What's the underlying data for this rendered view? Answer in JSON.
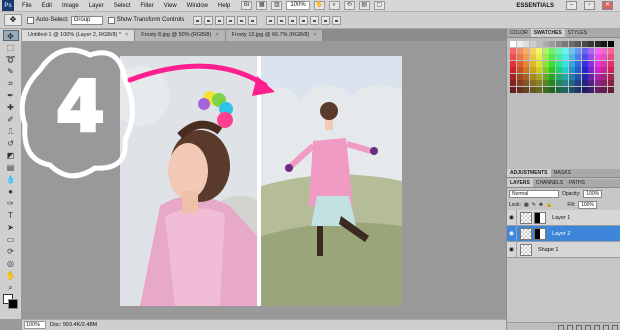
{
  "menubar": {
    "logo": "Ps",
    "items": [
      "File",
      "Edit",
      "Image",
      "Layer",
      "Select",
      "Filter",
      "View",
      "Window",
      "Help"
    ],
    "zoom": "100%",
    "workspace": "ESSENTIALS"
  },
  "options": {
    "auto_select_label": "Auto-Select:",
    "auto_select_value": "Group",
    "transform_label": "Show Transform Controls"
  },
  "tabs": [
    {
      "label": "Untitled-1 @ 100% (Layer 2, RGB/8) *",
      "active": true
    },
    {
      "label": "Frosty 8.jpg @ 50% (RGB/8)",
      "active": false
    },
    {
      "label": "Frosty 12.jpg @ 66.7% (RGB/8)",
      "active": false
    }
  ],
  "status": {
    "zoom": "100%",
    "doc": "Doc: 993.4K/2.48M"
  },
  "right_panel": {
    "top_tabs": [
      "COLOR",
      "SWATCHES",
      "STYLES"
    ],
    "adj_tabs": [
      "ADJUSTMENTS",
      "MASKS"
    ],
    "layer_tabs": [
      "LAYERS",
      "CHANNELS",
      "PATHS"
    ],
    "blend_mode": "Normal",
    "opacity_label": "Opacity:",
    "opacity": "100%",
    "lock_label": "Lock:",
    "fill_label": "Fill:",
    "fill": "100%",
    "layers": [
      {
        "name": "Layer 1",
        "selected": false
      },
      {
        "name": "Layer 2",
        "selected": true
      },
      {
        "name": "Shape 1",
        "selected": false
      }
    ]
  },
  "annotation": {
    "number": "4",
    "arrow_color": "#ff1f8f"
  }
}
